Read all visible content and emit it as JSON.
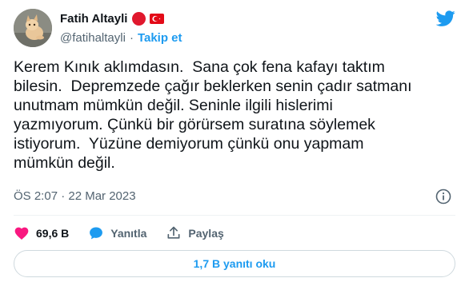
{
  "author": {
    "display_name": "Fatih Altayli",
    "handle": "@fatihaltayli",
    "separator": "·",
    "follow_label": "Takip et"
  },
  "tweet": {
    "text": "Kerem Kınık aklımdasın.  Sana çok fena kafayı taktım\nbilesin.  Depremzede çağır beklerken senin çadır satmanı\nunutmam mümkün değil. Seninle ilgili hislerimi\nyazmıyorum. Çünkü bir görürsem suratına söylemek\nistiyorum.  Yüzüne demiyorum çünkü onu yapmam\nmümkün değil.",
    "timestamp": "ÖS 2:07 · 22 Mar 2023"
  },
  "actions": {
    "likes_count": "69,6 B",
    "reply_label": "Yanıtla",
    "share_label": "Paylaş"
  },
  "replies_button": {
    "label": "1,7 B yanıtı oku"
  },
  "colors": {
    "accent": "#1d9bf0",
    "like": "#f91880",
    "flag_red": "#e30a17",
    "dot_red": "#e0182d"
  },
  "icons": [
    "twitter-bird-icon",
    "turkey-flag-icon",
    "info-icon",
    "heart-icon",
    "reply-bubble-icon",
    "share-icon"
  ]
}
